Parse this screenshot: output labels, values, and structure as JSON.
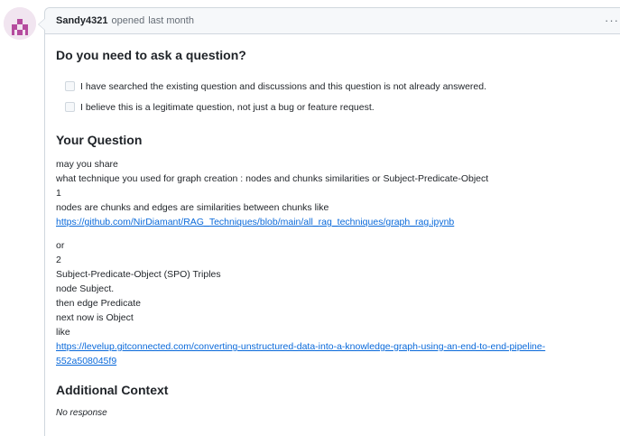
{
  "header": {
    "author": "Sandy4321",
    "action": "opened",
    "time": "last month",
    "more_icon": "kebab-horizontal-icon"
  },
  "colors": {
    "link": "#0969da",
    "border": "#d0d7de",
    "header_bg": "#f6f8fa",
    "avatar_magenta": "#b54b9e"
  },
  "form": {
    "question_heading": "Do you need to ask a question?",
    "checkboxes": [
      {
        "label": "I have searched the existing question and discussions and this question is not already answered.",
        "checked": false
      },
      {
        "label": "I believe this is a legitimate question, not just a bug or feature request.",
        "checked": false
      }
    ],
    "your_question_heading": "Your Question",
    "lines1": [
      "may you share",
      "what technique you used for graph creation : nodes and chunks similarities or Subject-Predicate-Object",
      "1",
      "nodes are chunks and edges are similarities between chunks like"
    ],
    "link1": "https://github.com/NirDiamant/RAG_Techniques/blob/main/all_rag_techniques/graph_rag.ipynb",
    "lines2": [
      "or",
      "2",
      "Subject-Predicate-Object (SPO) Triples",
      "node Subject.",
      "then edge Predicate",
      "next now is Object",
      "like"
    ],
    "link2_line1": "https://levelup.gitconnected.com/converting-unstructured-data-into-a-knowledge-graph-using-an-end-to-end-pipeline-",
    "link2_line2": "552a508045f9",
    "additional_heading": "Additional Context",
    "additional_value": "No response"
  }
}
